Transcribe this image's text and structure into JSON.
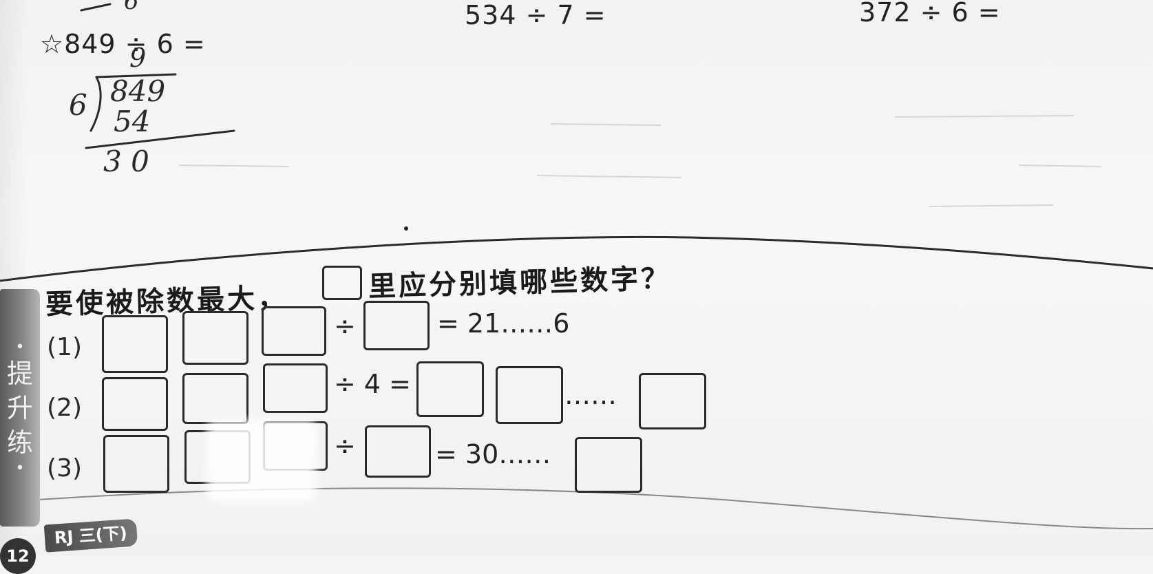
{
  "top_problems": {
    "p_left": "☆849 ÷ 6 =",
    "p_mid": "534 ÷ 7 =",
    "p_right": "372 ÷ 6 ="
  },
  "handwritten": {
    "divisor": "6",
    "dividend": "849",
    "quotient_digit": "9",
    "product": "54",
    "remainder": "3 0",
    "top_scribble": "6"
  },
  "section": {
    "side_label": [
      "提",
      "升",
      "练"
    ],
    "heading_before": "要使被除数最大，",
    "heading_after": "里应分别填哪些数字？"
  },
  "rows": [
    {
      "label": "(1)",
      "op1": "÷",
      "op2": "= 21……6"
    },
    {
      "label": "(2)",
      "op1": "÷ 4 =",
      "op2": "……"
    },
    {
      "label": "(3)",
      "op1": "÷",
      "op2": "= 30……"
    }
  ],
  "footer": {
    "page_number": "12",
    "tag": "RJ 三(下)"
  }
}
